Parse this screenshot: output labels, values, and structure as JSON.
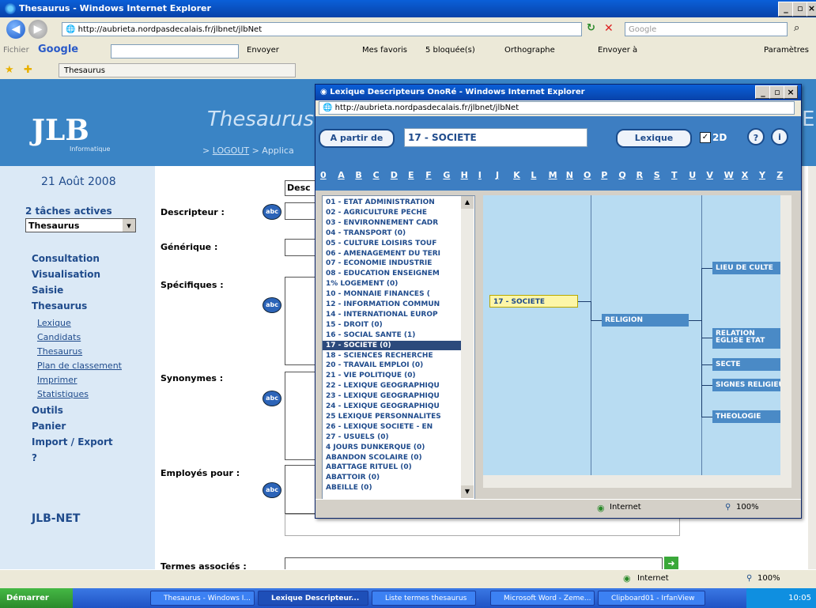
{
  "ie": {
    "title": "Thesaurus - Windows Internet Explorer",
    "url": "http://aubrieta.nordpasdecalais.fr/jlbnet/jlbNet",
    "search_placeholder": "Google",
    "menu_fichier": "Fichier",
    "google_label": "Google",
    "envoyer": "Envoyer",
    "mes_favoris": "Mes favoris",
    "bloquees": "5 bloquée(s)",
    "orthographe": "Orthographe",
    "envoyer_a": "Envoyer à",
    "parametres": "Paramètres",
    "tab_label": "Thesaurus",
    "status_zone": "Internet",
    "zoom": "100%"
  },
  "page": {
    "header_title": "Thesaurus",
    "header_right": "E",
    "logo": "JLB",
    "logo_sub": "Informatique",
    "date": "21 Août 2008",
    "tasks_label": "2 tâches actives",
    "task_select": "Thesaurus",
    "breadcrumb_logout": "LOGOUT",
    "breadcrumb_app": "Applica",
    "menu": {
      "consultation": "Consultation",
      "visualisation": "Visualisation",
      "saisie": "Saisie",
      "thesaurus": "Thesaurus",
      "sub": [
        "Lexique",
        "Candidats",
        "Thesaurus",
        "Plan de classement",
        "Imprimer",
        "Statistiques"
      ],
      "outils": "Outils",
      "panier": "Panier",
      "import_export": "Import / Export",
      "help": "?"
    },
    "footer_brand": "JLB-NET",
    "form": {
      "desc_tab": "Desc",
      "descripteur": "Descripteur :",
      "generique": "Générique :",
      "specifiques": "Spécifiques :",
      "synonymes": "Synonymes :",
      "employes": "Employés pour :",
      "termes": "Termes associés :",
      "abc": "abc"
    }
  },
  "popup": {
    "title": "Lexique Descripteurs OnoRé - Windows Internet Explorer",
    "url": "http://aubrieta.nordpasdecalais.fr/jlbnet/jlbNet",
    "a_partir_de": "A partir de",
    "search_value": "17 - SOCIETE",
    "lexique_btn": "Lexique",
    "check_2d": "2D",
    "letters": [
      "0",
      "A",
      "B",
      "C",
      "D",
      "E",
      "F",
      "G",
      "H",
      "I",
      "J",
      "K",
      "L",
      "M",
      "N",
      "O",
      "P",
      "Q",
      "R",
      "S",
      "T",
      "U",
      "V",
      "W",
      "X",
      "Y",
      "Z"
    ],
    "list_items": [
      "01 - ETAT ADMINISTRATION",
      "02 - AGRICULTURE PECHE",
      "03 - ENVIRONNEMENT CADR",
      "04 - TRANSPORT   (0)",
      "05 - CULTURE LOISIRS TOUF",
      "06 - AMENAGEMENT DU TERI",
      "07 - ECONOMIE INDUSTRIE",
      "08 - EDUCATION ENSEIGNEM",
      "1% LOGEMENT   (0)",
      "10 - MONNAIE FINANCES   (",
      "12 - INFORMATION COMMUN",
      "14 - INTERNATIONAL EUROP",
      "15 - DROIT   (0)",
      "16 - SOCIAL SANTE   (1)",
      "17 - SOCIETE   (0)",
      "18 - SCIENCES RECHERCHE",
      "20 - TRAVAIL EMPLOI   (0)",
      "21 - VIE POLITIQUE   (0)",
      "22 - LEXIQUE GEOGRAPHIQU",
      "23 - LEXIQUE GEOGRAPHIQU",
      "24 - LEXIQUE GEOGRAPHIQU",
      "25 LEXIQUE PERSONNALITES",
      "26 - LEXIQUE SOCIETE - EN",
      "27 - USUELS   (0)",
      "4 JOURS DUNKERQUE   (0)",
      "ABANDON SCOLAIRE   (0)",
      "ABATTAGE RITUEL   (0)",
      "ABATTOIR   (0)",
      "ABEILLE   (0)"
    ],
    "selected_index": 14,
    "graph": {
      "root": "17 - SOCIETE",
      "child": "RELIGION",
      "leaves": [
        "LIEU DE CULTE",
        "RELATION EGLISE ETAT",
        "SECTE",
        "SIGNES RELIGIEUX",
        "THEOLOGIE"
      ]
    },
    "status_zone": "Internet",
    "zoom": "100%"
  },
  "taskbar": {
    "start": "Démarrer",
    "tasks": [
      "Thesaurus - Windows I...",
      "Lexique Descripteur...",
      "Liste termes thesaurus",
      "Microsoft Word - Zeme...",
      "Clipboard01 - IrfanView"
    ],
    "clock": "10:05"
  }
}
